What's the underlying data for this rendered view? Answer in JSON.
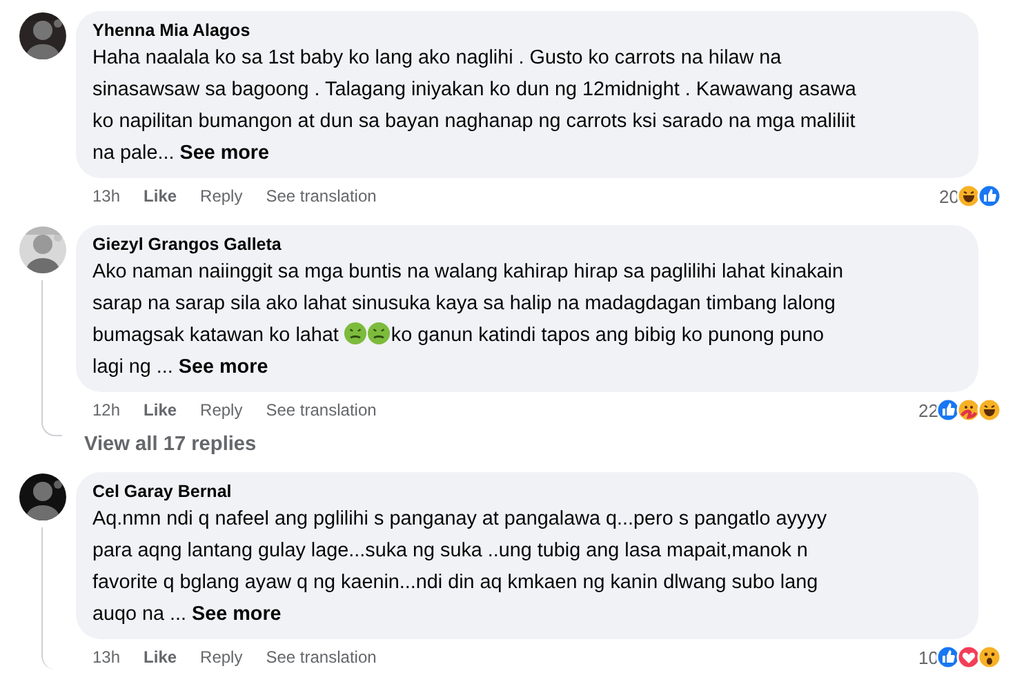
{
  "comments": [
    {
      "author": "Yhenna Mia Alagos",
      "avatar": {
        "kind": "picture"
      },
      "body": [
        {
          "kind": "text",
          "text": "Haha naalala ko sa 1st baby ko lang ako naglihi . Gusto ko carrots na hilaw na\nsinasawsaw sa bagoong . Talagang iniyakan ko dun ng 12midnight . Kawawang asawa\nko napilitan bumangon at dun sa bayan naghanap ng carrots ksi sarado na mga maliliit\nna pale... **See more**"
        }
      ],
      "time": "13h",
      "actions": [
        "Like",
        "Reply",
        "See translation"
      ],
      "reaction_count": "20",
      "reactions": [
        {
          "kind": "haha"
        },
        {
          "kind": "like"
        }
      ],
      "thread": false
    },
    {
      "author": "Giezyl Grangos Galleta",
      "avatar": {
        "kind": "picture"
      },
      "body": [
        {
          "kind": "text",
          "text": "Ako naman naiinggit sa mga buntis na walang kahirap hirap sa paglilihi lahat kinakain\nsarap na sarap sila ako lahat sinusuka kaya sa halip na madagdagan timbang lalong\nbumagsak katawan ko lahat "
        },
        {
          "kind": "emoji"
        },
        {
          "kind": "emoji"
        },
        {
          "kind": "text",
          "text": "ko ganun katindi tapos ang bibig ko punong puno\nlagi ng ... **See more**"
        }
      ],
      "time": "12h",
      "actions": [
        "Like",
        "Reply",
        "See translation"
      ],
      "reaction_count": "22",
      "reactions": [
        {
          "kind": "like"
        },
        {
          "kind": "care"
        },
        {
          "kind": "haha"
        }
      ],
      "thread": true,
      "replies_link": "View all 17 replies"
    },
    {
      "author": "Cel Garay Bernal",
      "avatar": {
        "kind": "picture"
      },
      "body": [
        {
          "kind": "text",
          "text": "Aq.nmn ndi q nafeel ang pglilihi s panganay at pangalawa q...pero s pangatlo ayyyy\npara aqng lantang gulay lage...suka ng suka ..ung tubig ang lasa mapait,manok n\nfavorite q bglang ayaw q ng kaenin...ndi din aq kmkaen ng kanin dlwang subo lang\nauqo na ... **See more**"
        }
      ],
      "time": "13h",
      "actions": [
        "Like",
        "Reply",
        "See translation"
      ],
      "reaction_count": "10",
      "reactions": [
        {
          "kind": "like"
        },
        {
          "kind": "love"
        },
        {
          "kind": "wow"
        }
      ],
      "thread": true
    }
  ]
}
